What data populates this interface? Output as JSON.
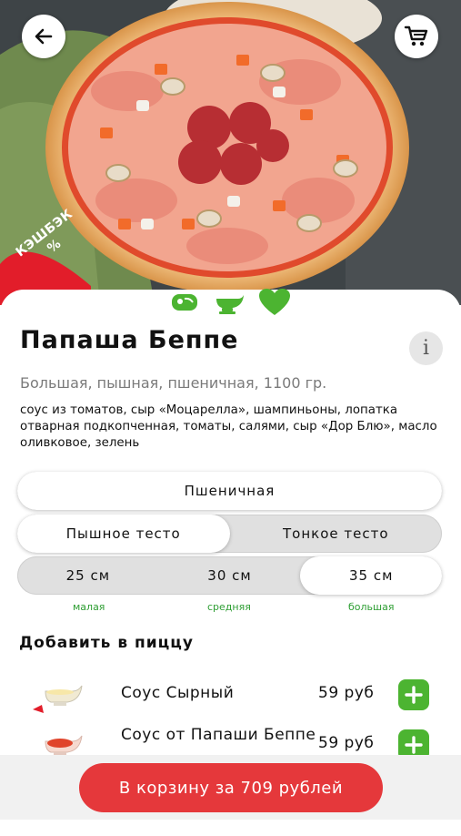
{
  "hero": {
    "cashback_line1": "КЭШБЭК",
    "cashback_line2": "%"
  },
  "product": {
    "title": "Папаша Беппе",
    "info_label": "i",
    "subtitle": "Большая, пышная, пшеничная, 1100 гр.",
    "description": "соус из томатов, сыр «Моцарелла», шампиньоны, лопатка отварная подкопченная, томаты, салями, сыр «Дор Блю», масло оливковое, зелень"
  },
  "options": {
    "flour": {
      "options": [
        "Пшеничная"
      ],
      "selected": 0
    },
    "dough": {
      "options": [
        "Пышное тесто",
        "Тонкое тесто"
      ],
      "selected": 0
    },
    "size": {
      "options": [
        "25 см",
        "30 см",
        "35 см"
      ],
      "labels": [
        "малая",
        "средняя",
        "большая"
      ],
      "selected": 2
    }
  },
  "addons": {
    "title": "Добавить в пиццу",
    "items": [
      {
        "name": "Соус Сырный",
        "price": "59 руб"
      },
      {
        "name": "Соус от Папаши Беппе",
        "price": "59 руб"
      }
    ]
  },
  "cart": {
    "button_label": "В корзину за 709 рублей"
  },
  "colors": {
    "accent_red": "#e5383b",
    "accent_green": "#4cb431",
    "size_label_green": "#2e9e33"
  },
  "icons": [
    "back-arrow-icon",
    "cart-icon",
    "meat-icon",
    "gravy-boat-icon",
    "heart-icon",
    "plus-icon"
  ]
}
